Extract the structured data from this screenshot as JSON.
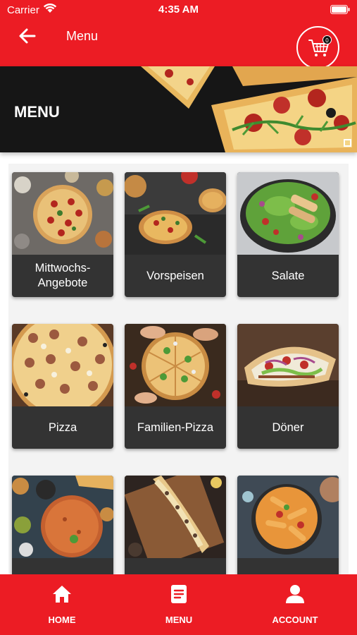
{
  "status": {
    "carrier": "Carrier",
    "time": "4:35 AM"
  },
  "navbar": {
    "title": "Menu",
    "cart_count": "0",
    "back_icon": "arrow-left-icon",
    "cart_icon": "shopping-cart-icon"
  },
  "hero": {
    "title": "MENU"
  },
  "categories": [
    {
      "label": "Mittwochs-Angebote"
    },
    {
      "label": "Vorspeisen"
    },
    {
      "label": "Salate"
    },
    {
      "label": "Pizza"
    },
    {
      "label": "Familien-Pizza"
    },
    {
      "label": "Döner"
    }
  ],
  "bottom_nav": [
    {
      "label": "HOME",
      "icon": "home-icon"
    },
    {
      "label": "MENU",
      "icon": "menu-list-icon"
    },
    {
      "label": "ACCOUNT",
      "icon": "user-icon"
    }
  ],
  "colors": {
    "brand_red": "#ec1c24",
    "card_label_bg": "#333333",
    "hero_bg": "#161616"
  }
}
